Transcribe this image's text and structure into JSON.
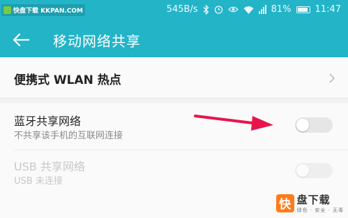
{
  "watermark": {
    "text": "快盘下载 KKPAN.COM"
  },
  "status_bar": {
    "speed": "545B/s",
    "battery": "81%",
    "time": "11:47"
  },
  "header": {
    "title": "移动网络共享"
  },
  "wlan": {
    "label": "便携式 WLAN 热点"
  },
  "bluetooth": {
    "title": "蓝牙共享网络",
    "subtitle": "不共享该手机的互联网连接",
    "enabled": false
  },
  "usb": {
    "title": "USB 共享网络",
    "subtitle": "USB 未连接",
    "enabled": false
  },
  "brand": {
    "mark": "快",
    "name": "盘下载",
    "slogan": "绿色 · 安全 · 无毒"
  },
  "colors": {
    "accent": "#23b4c8",
    "annotation_arrow": "#e8154b"
  }
}
